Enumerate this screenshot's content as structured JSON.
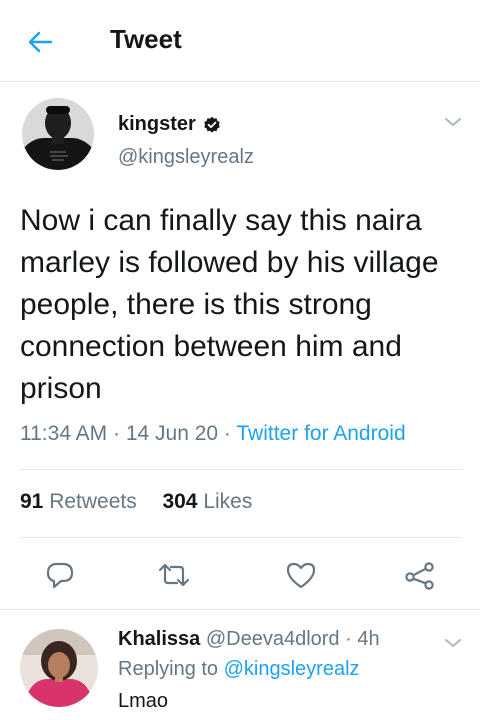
{
  "header": {
    "title": "Tweet",
    "back_icon": "arrow-left-icon",
    "accent_color": "#1da1f2"
  },
  "tweet": {
    "author_name": "kingster",
    "author_handle": "@kingsleyrealz",
    "verified_icon": "badge-icon",
    "text": "Now i can finally say this naira marley is followed by his village people, there is this strong connection between him and prison",
    "time": "11:34 AM",
    "date": "14 Jun 20",
    "separator": " · ",
    "source": "Twitter for Android",
    "retweets_count": "91",
    "retweets_label": "Retweets",
    "likes_count": "304",
    "likes_label": "Likes"
  },
  "actions": {
    "reply_icon": "reply-icon",
    "retweet_icon": "retweet-icon",
    "like_icon": "heart-icon",
    "share_icon": "share-icon"
  },
  "reply": {
    "name": "Khalissa",
    "handle": "@Deeva4dlord",
    "time": "4h",
    "separator": " · ",
    "replying_prefix": "Replying to",
    "replying_handle": "@kingsleyrealz",
    "text": "Lmao"
  },
  "colors": {
    "text_primary": "#14171a",
    "text_secondary": "#657786",
    "link": "#1da1f2",
    "border": "#e1e8ed"
  }
}
